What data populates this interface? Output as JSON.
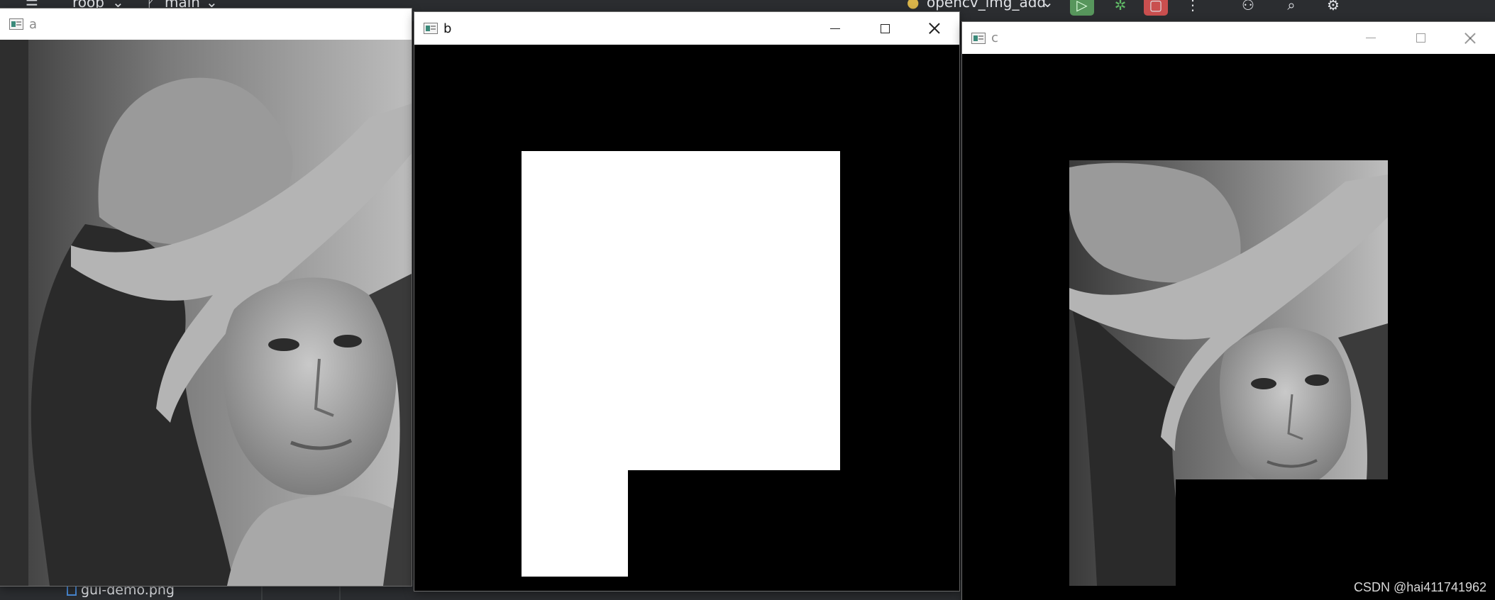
{
  "ide": {
    "project_name": "roop",
    "branch": "main",
    "run_config": "opencv_img_add",
    "file_name": "gui-demo.png",
    "icons": [
      "menu-icon",
      "chevron-down-icon",
      "branch-icon",
      "python-icon",
      "run-icon",
      "debug-icon",
      "stop-icon",
      "more-icon",
      "add-profile-icon",
      "search-icon",
      "settings-icon"
    ]
  },
  "windows": {
    "a": {
      "title": "a"
    },
    "b": {
      "title": "b"
    },
    "c": {
      "title": "c"
    }
  },
  "colors": {
    "ide_background": "#2b2d30",
    "mask_white": "#ffffff",
    "mask_black": "#000000",
    "run_button": "#57965c",
    "stop_button": "#c94f4f"
  },
  "watermark": "CSDN @hai411741962"
}
